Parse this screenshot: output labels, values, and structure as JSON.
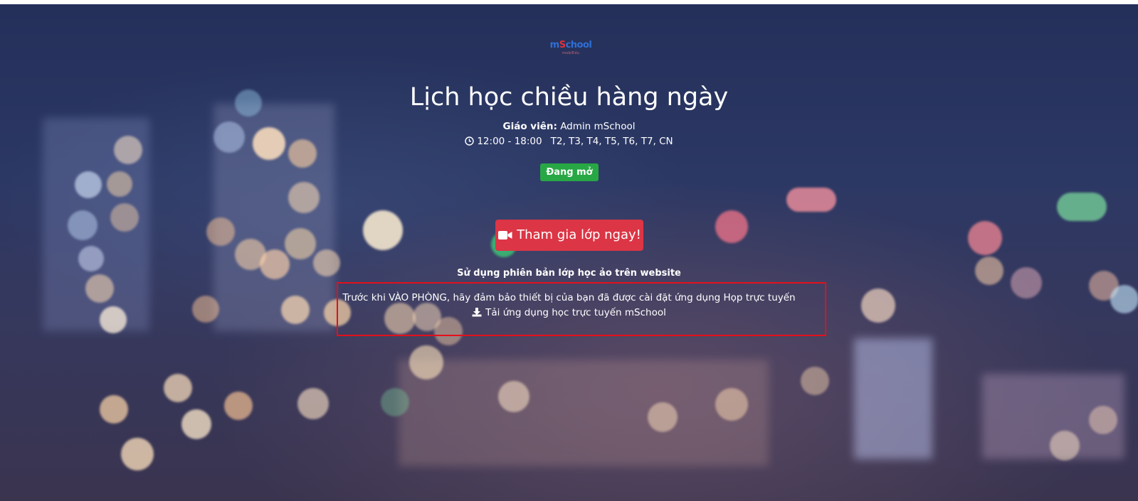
{
  "logo": {
    "main_prefix": "m",
    "main_accent": "S",
    "main_suffix": "chool",
    "sub": "mobiEdu"
  },
  "class": {
    "title": "Lịch học chiều hàng ngày",
    "teacher_label": "Giáo viên:",
    "teacher_name": "Admin mSchool",
    "time": "12:00 - 18:00",
    "days": "T2, T3, T4, T5, T6, T7, CN",
    "status": "Đang mở"
  },
  "actions": {
    "join_label": "Tham gia lớp ngay!",
    "web_version": "Sử dụng phiên bản lớp học ảo trên website",
    "note": "Trước khi VÀO PHÒNG, hãy đảm bảo thiết bị của bạn đã được cài đặt ứng dụng Họp trực tuyến",
    "download_label": "Tải ứng dụng học trực tuyến mSchool"
  },
  "colors": {
    "status_green": "#28a745",
    "join_red": "#dc3545",
    "highlight_red": "#e3101b",
    "logo_blue": "#2f6fd6"
  },
  "icons": [
    "clock-icon",
    "video-camera-icon",
    "download-icon"
  ]
}
